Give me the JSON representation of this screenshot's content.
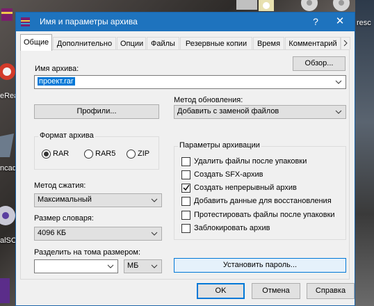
{
  "dialog": {
    "title": "Имя и параметры архива",
    "help_glyph": "?",
    "close_glyph": "✕"
  },
  "tabs": [
    {
      "label": "Общие",
      "active": true
    },
    {
      "label": "Дополнительно",
      "active": false
    },
    {
      "label": "Опции",
      "active": false
    },
    {
      "label": "Файлы",
      "active": false
    },
    {
      "label": "Резервные копии",
      "active": false
    },
    {
      "label": "Время",
      "active": false
    },
    {
      "label": "Комментарий",
      "active": false
    }
  ],
  "archive_name": {
    "label": "Имя архива:",
    "value": "проект.rar",
    "browse_label": "Обзор..."
  },
  "profiles_label": "Профили...",
  "update_method": {
    "label": "Метод обновления:",
    "value": "Добавить с заменой файлов"
  },
  "archive_format": {
    "title": "Формат архива",
    "options": [
      {
        "label": "RAR",
        "selected": true
      },
      {
        "label": "RAR5",
        "selected": false
      },
      {
        "label": "ZIP",
        "selected": false
      }
    ]
  },
  "compression": {
    "label": "Метод сжатия:",
    "value": "Максимальный"
  },
  "dictionary": {
    "label": "Размер словаря:",
    "value": "4096 КБ"
  },
  "volumes": {
    "label": "Разделить на тома размером:",
    "value": "",
    "unit": "МБ"
  },
  "archive_options": {
    "title": "Параметры архивации",
    "items": [
      {
        "label": "Удалить файлы после упаковки",
        "checked": false
      },
      {
        "label": "Создать SFX-архив",
        "checked": false
      },
      {
        "label": "Создать непрерывный архив",
        "checked": true
      },
      {
        "label": "Добавить данные для восстановления",
        "checked": false
      },
      {
        "label": "Протестировать файлы после упаковки",
        "checked": false
      },
      {
        "label": "Заблокировать архив",
        "checked": false
      }
    ]
  },
  "set_password_label": "Установить пароль...",
  "footer": {
    "ok_label": "OK",
    "cancel_label": "Отмена",
    "help_label": "Справка"
  },
  "desktop": {
    "labels": [
      "eRea",
      "ncad",
      "alSO",
      "resc"
    ]
  },
  "colors": {
    "titlebar": "#1e73be",
    "accent": "#0078d7",
    "dialog_bg": "#f0f0f0"
  }
}
